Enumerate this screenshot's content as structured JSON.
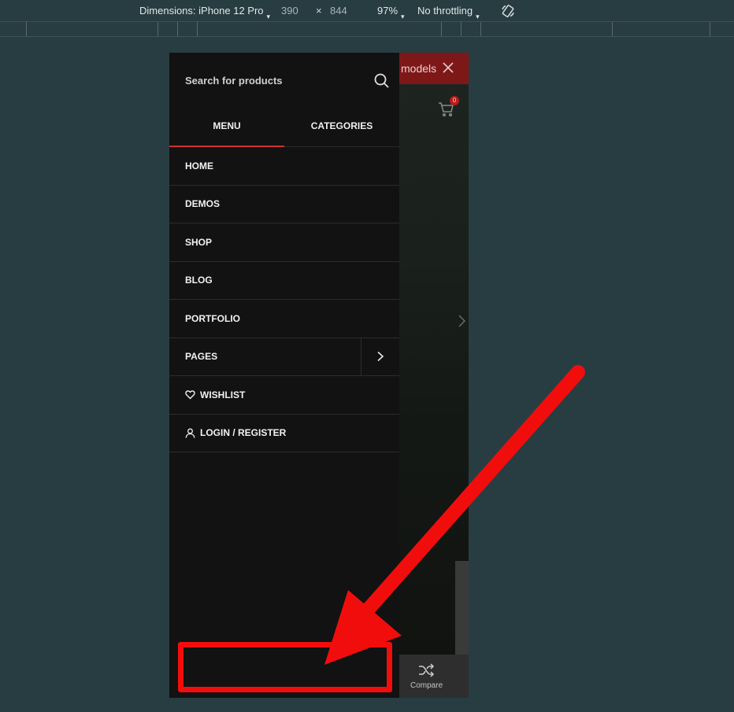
{
  "devtools": {
    "dimensions": "Dimensions: iPhone 12 Pro",
    "width": "390",
    "times": "×",
    "height": "844",
    "zoom": "97%",
    "throttling": "No throttling",
    "caret": "▾"
  },
  "site": {
    "promo_text": "models",
    "cart_count": "0",
    "compare_label": "Compare"
  },
  "menu_panel": {
    "search_placeholder": "Search for products",
    "tabs": [
      {
        "label": "MENU",
        "active": true
      },
      {
        "label": "CATEGORIES",
        "active": false
      }
    ],
    "items": [
      {
        "label": "HOME"
      },
      {
        "label": "DEMOS"
      },
      {
        "label": "SHOP"
      },
      {
        "label": "BLOG"
      },
      {
        "label": "PORTFOLIO"
      },
      {
        "label": "PAGES",
        "has_submenu": true
      },
      {
        "label": "WISHLIST",
        "icon": "heart-icon"
      },
      {
        "label": "LOGIN / REGISTER",
        "icon": "user-icon"
      }
    ]
  },
  "annotation": {
    "color": "#f20d0d"
  }
}
